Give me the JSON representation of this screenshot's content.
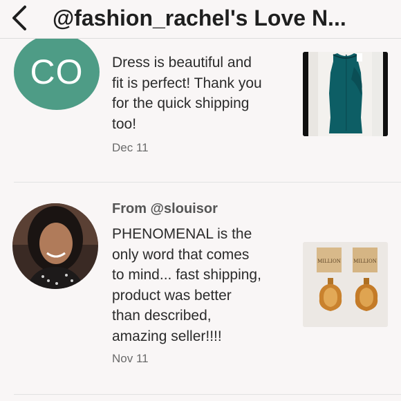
{
  "header": {
    "title": "@fashion_rachel's Love N...",
    "back_icon": "chevron-left-icon"
  },
  "reviews": [
    {
      "initials": "CO",
      "avatar_color": "#4e9c86",
      "text": "Dress is beautiful and\nfit is perfect! Thank you\nfor the quick shipping\ntoo!",
      "date": "Dec 11",
      "image": "teal-dress-photo"
    },
    {
      "from": "From @slouisor",
      "avatar": "profile-photo",
      "text": "PHENOMENAL is the\nonly word that comes\nto mind... fast shipping,\nproduct was better\nthan described,\namazing seller!!!!",
      "date": "Nov 11",
      "image": "perfume-bottles-photo",
      "product_box_label": "MILLION"
    }
  ]
}
